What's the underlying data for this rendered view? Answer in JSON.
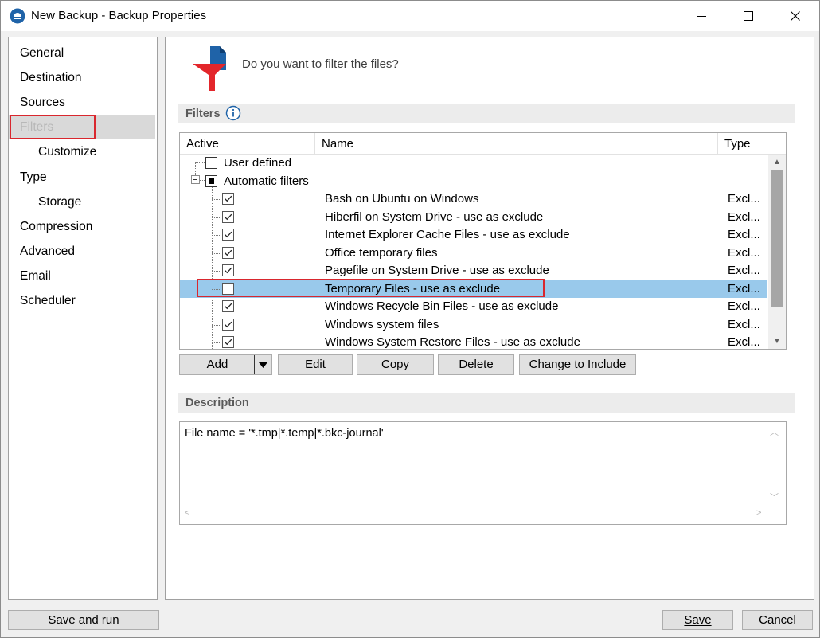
{
  "window": {
    "title": "New Backup - Backup Properties",
    "controls": {
      "minimize": "minimize-icon",
      "maximize": "maximize-icon",
      "close": "close-icon"
    }
  },
  "nav": {
    "items": [
      {
        "label": "General"
      },
      {
        "label": "Destination"
      },
      {
        "label": "Sources"
      },
      {
        "label": "Filters",
        "selected": true
      },
      {
        "label": "Customize",
        "sub": true
      },
      {
        "label": "Type"
      },
      {
        "label": "Storage",
        "sub": true
      },
      {
        "label": "Compression"
      },
      {
        "label": "Advanced"
      },
      {
        "label": "Email"
      },
      {
        "label": "Scheduler"
      }
    ]
  },
  "main": {
    "question": "Do you want to filter the files?",
    "filters_header": "Filters",
    "columns": {
      "active": "Active",
      "name": "Name",
      "type": "Type"
    },
    "tree": {
      "user_defined": "User defined",
      "automatic": "Automatic filters"
    },
    "rows": [
      {
        "name": "Bash on Ubuntu on Windows",
        "type": "Excl...",
        "checked": true
      },
      {
        "name": "Hiberfil on System Drive - use as exclude",
        "type": "Excl...",
        "checked": true
      },
      {
        "name": "Internet Explorer Cache Files - use as exclude",
        "type": "Excl...",
        "checked": true
      },
      {
        "name": "Office temporary files",
        "type": "Excl...",
        "checked": true
      },
      {
        "name": "Pagefile on System Drive - use as exclude",
        "type": "Excl...",
        "checked": true
      },
      {
        "name": "Temporary Files - use as exclude",
        "type": "Excl...",
        "checked": false,
        "selected": true
      },
      {
        "name": "Windows Recycle Bin Files - use as exclude",
        "type": "Excl...",
        "checked": true
      },
      {
        "name": "Windows system files",
        "type": "Excl...",
        "checked": true
      },
      {
        "name": "Windows System Restore Files - use as exclude",
        "type": "Excl...",
        "checked": true
      }
    ],
    "buttons": {
      "add": "Add",
      "edit": "Edit",
      "copy": "Copy",
      "delete": "Delete",
      "change": "Change to Include"
    },
    "description_header": "Description",
    "description_text": "File name = '*.tmp|*.temp|*.bkc-journal'"
  },
  "footer": {
    "save_and_run": "Save and run",
    "save": "Save",
    "cancel": "Cancel"
  },
  "colors": {
    "selection": "#99c9eb",
    "highlight_border": "#d9272e",
    "funnel": "#e3262b",
    "doc_icon": "#1f63a8"
  }
}
